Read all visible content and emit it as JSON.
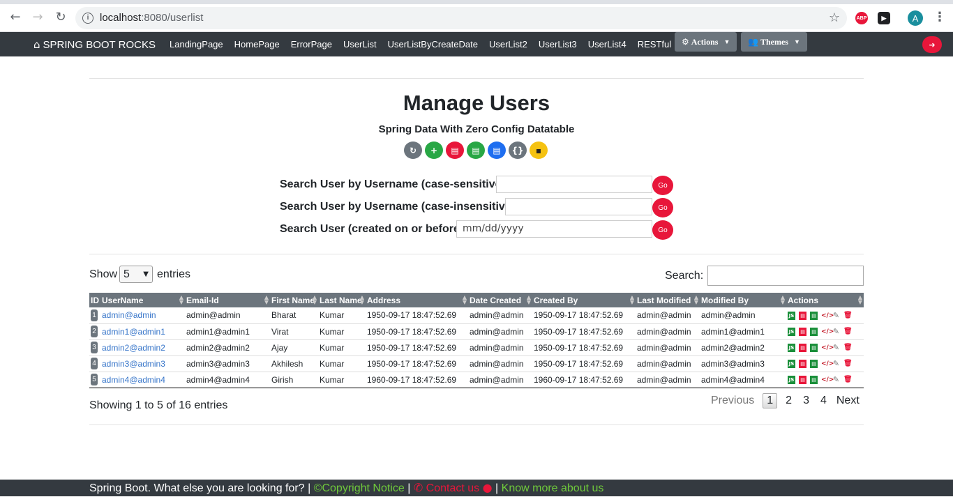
{
  "browser": {
    "url_host": "localhost",
    "url_path": ":8080/userlist",
    "ext_abp": "ABP",
    "avatar_letter": "A"
  },
  "navbar": {
    "brand": "SPRING BOOT ROCKS",
    "links": [
      "LandingPage",
      "HomePage",
      "ErrorPage",
      "UserList",
      "UserListByCreateDate",
      "UserList2",
      "UserList3",
      "UserList4",
      "RESTful"
    ],
    "actions_label": "Actions",
    "themes_label": "Themes"
  },
  "page": {
    "title": "Manage Users",
    "subtitle": "Spring Data With Zero Config Datatable",
    "action_buttons": [
      {
        "icon": "refresh-icon",
        "color": "#6c757d"
      },
      {
        "icon": "plus-icon",
        "color": "#28a745"
      },
      {
        "icon": "pdf-icon",
        "color": "#e8163a"
      },
      {
        "icon": "csv-icon",
        "color": "#28a745"
      },
      {
        "icon": "excel-icon",
        "color": "#1e6ef0"
      },
      {
        "icon": "json-icon",
        "color": "#6c757d"
      },
      {
        "icon": "file-icon",
        "color": "#f5c211"
      }
    ]
  },
  "search_forms": {
    "case_sensitive_label": "Search User by Username (case-sensitive):",
    "case_insensitive_label": "Search User by Username (case-insensitive):",
    "created_label": "Search User (created on or before):",
    "date_placeholder": "mm/dd/yyyy",
    "go_label": "Go"
  },
  "table_controls": {
    "show_label": "Show",
    "entries_label": "entries",
    "page_size": "5",
    "search_label": "Search:"
  },
  "table": {
    "columns": [
      "ID",
      "UserName",
      "Email-Id",
      "First Name",
      "Last Name",
      "Address",
      "Date Created",
      "Created By",
      "Last Modified",
      "Modified By",
      "Actions"
    ],
    "rows": [
      {
        "id": "1",
        "username": "admin@admin",
        "email": "admin@admin",
        "first": "Bharat",
        "last": "Kumar",
        "address": "1950-09-17 18:47:52.69",
        "date_created": "admin@admin",
        "created_by": "1950-09-17 18:47:52.69",
        "last_modified": "admin@admin",
        "modified_by": "admin@admin"
      },
      {
        "id": "2",
        "username": "admin1@admin1",
        "email": "admin1@admin1",
        "first": "Virat",
        "last": "Kumar",
        "address": "1950-09-17 18:47:52.69",
        "date_created": "admin@admin",
        "created_by": "1950-09-17 18:47:52.69",
        "last_modified": "admin@admin",
        "modified_by": "admin1@admin1"
      },
      {
        "id": "3",
        "username": "admin2@admin2",
        "email": "admin2@admin2",
        "first": "Ajay",
        "last": "Kumar",
        "address": "1950-09-17 18:47:52.69",
        "date_created": "admin@admin",
        "created_by": "1950-09-17 18:47:52.69",
        "last_modified": "admin@admin",
        "modified_by": "admin2@admin2"
      },
      {
        "id": "4",
        "username": "admin3@admin3",
        "email": "admin3@admin3",
        "first": "Akhilesh",
        "last": "Kumar",
        "address": "1950-09-17 18:47:52.69",
        "date_created": "admin@admin",
        "created_by": "1950-09-17 18:47:52.69",
        "last_modified": "admin@admin",
        "modified_by": "admin3@admin3"
      },
      {
        "id": "5",
        "username": "admin4@admin4",
        "email": "admin4@admin4",
        "first": "Girish",
        "last": "Kumar",
        "address": "1960-09-17 18:47:52.69",
        "date_created": "admin@admin",
        "created_by": "1960-09-17 18:47:52.69",
        "last_modified": "admin@admin",
        "modified_by": "admin4@admin4"
      }
    ]
  },
  "pagination": {
    "info": "Showing 1 to 5 of 16 entries",
    "previous": "Previous",
    "pages": [
      "1",
      "2",
      "3",
      "4"
    ],
    "current": "1",
    "next": "Next"
  },
  "footer": {
    "text": "Spring Boot. What else you are looking for? |",
    "copyright": "Copyright Notice",
    "sep": "|",
    "contact": "Contact us",
    "know_more": "Know more about us"
  }
}
